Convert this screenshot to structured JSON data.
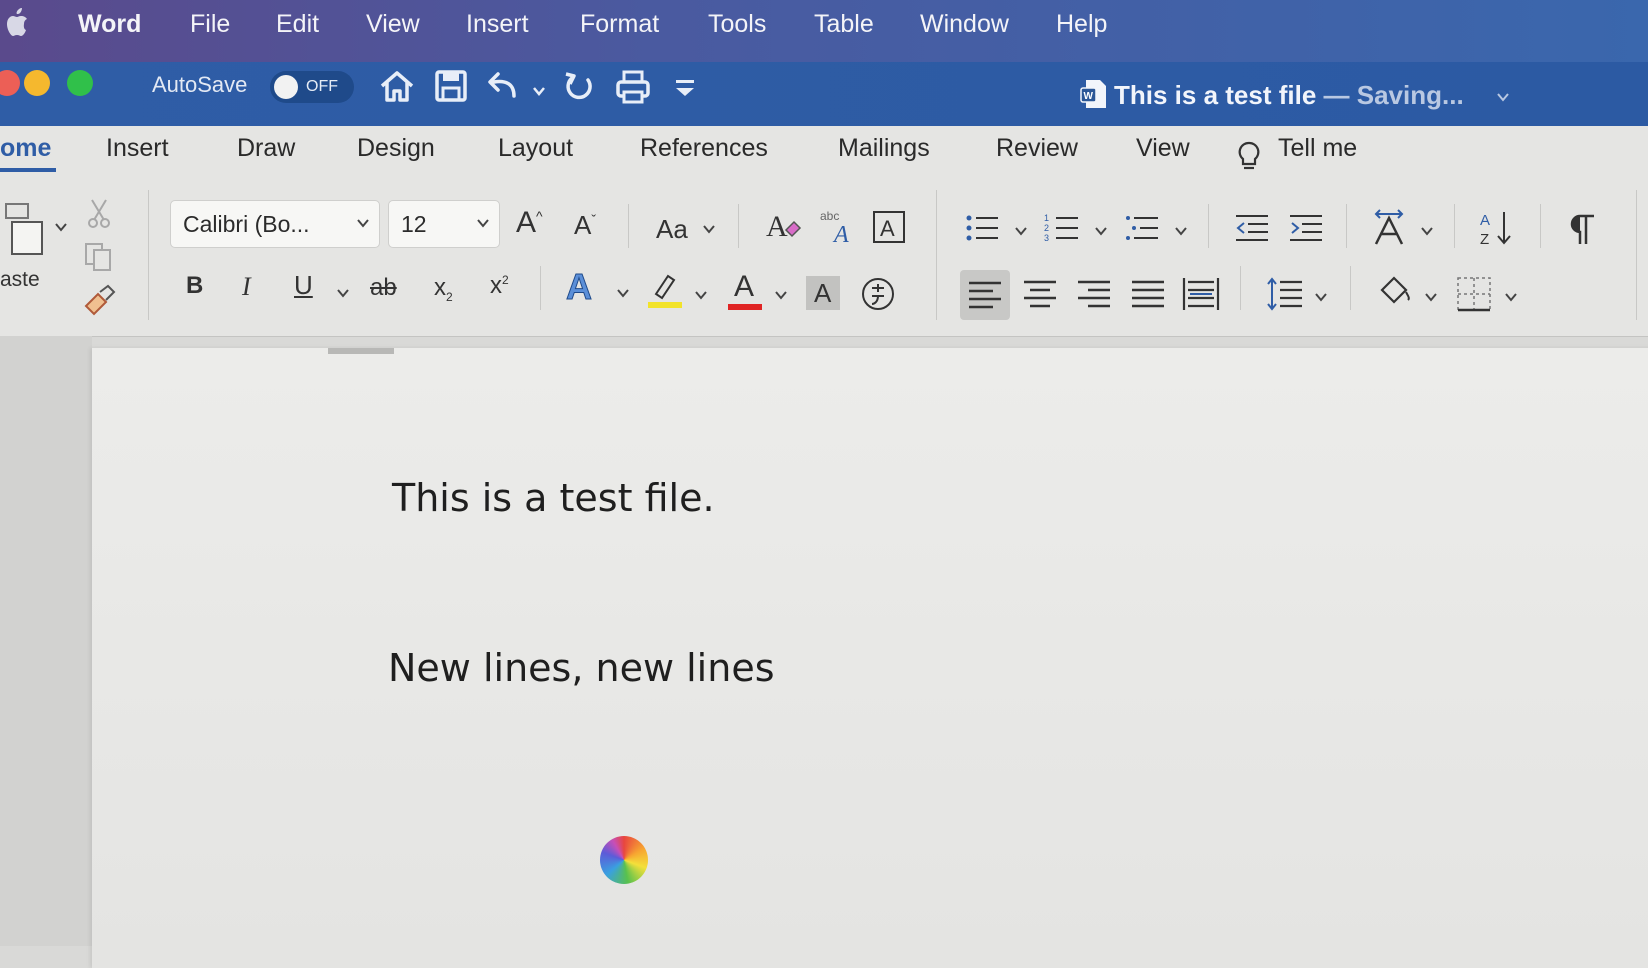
{
  "menubar": {
    "app": "Word",
    "items": [
      "File",
      "Edit",
      "View",
      "Insert",
      "Format",
      "Tools",
      "Table",
      "Window",
      "Help"
    ]
  },
  "titlebar": {
    "autosave_label": "AutoSave",
    "autosave_state": "OFF",
    "doc_title": "This is a test file",
    "doc_status": " — Saving...",
    "colors": {
      "close": "#ec5f56",
      "minimize": "#f5b82e",
      "maximize": "#30c04a"
    }
  },
  "ribbon": {
    "tabs": [
      "ome",
      "Insert",
      "Draw",
      "Design",
      "Layout",
      "References",
      "Mailings",
      "Review",
      "View"
    ],
    "tell_me": "Tell me",
    "paste_label": "aste",
    "font_name": "Calibri (Bo...",
    "font_size": "12",
    "change_case_label": "Aa",
    "grow_font": "A",
    "shrink_font": "A",
    "bold": "B",
    "italic": "I",
    "underline": "U",
    "strike": "ab",
    "subscript": "x",
    "superscript": "x",
    "text_effects": "A",
    "font_color": "A",
    "char_shading": "A",
    "colors": {
      "highlight": "#f2e32a",
      "font_color_bar": "#e02424",
      "active_tab": "#2f5da6"
    }
  },
  "document": {
    "paragraphs": [
      "This is a test file.",
      "New lines, new lines"
    ]
  }
}
